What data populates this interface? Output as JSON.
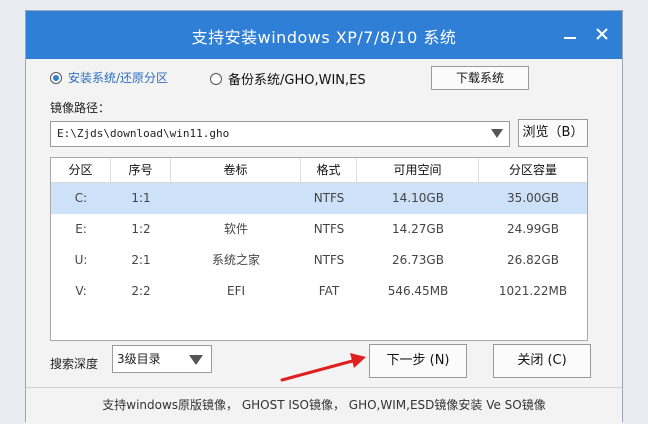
{
  "window": {
    "title": "支持安装windows XP/7/8/10 系统",
    "minimize_label": "minimize",
    "close_label": "close"
  },
  "mode": {
    "install_label": "安装系统/还原分区",
    "backup_label": "备份系统/GHO,WIN,ES",
    "selected": "install",
    "download_button": "下载系统"
  },
  "image_path": {
    "label": "镜像路径：",
    "value": "E:\\Zjds\\download\\win11.gho",
    "browse_button": "浏览（B）"
  },
  "partition_table": {
    "headers": [
      "分区",
      "序号",
      "卷标",
      "格式",
      "可用空间",
      "分区容量"
    ],
    "rows": [
      {
        "drive": "C:",
        "index": "1:1",
        "label": "",
        "format": "NTFS",
        "free": "14.10GB",
        "capacity": "35.00GB",
        "selected": true
      },
      {
        "drive": "E:",
        "index": "1:2",
        "label": "软件",
        "format": "NTFS",
        "free": "14.27GB",
        "capacity": "24.99GB",
        "selected": false
      },
      {
        "drive": "U:",
        "index": "2:1",
        "label": "系统之家",
        "format": "NTFS",
        "free": "26.73GB",
        "capacity": "26.82GB",
        "selected": false
      },
      {
        "drive": "V:",
        "index": "2:2",
        "label": "EFI",
        "format": "FAT",
        "free": "546.45MB",
        "capacity": "1021.22MB",
        "selected": false
      }
    ]
  },
  "search_depth": {
    "label": "搜索深度",
    "value": "3级目录"
  },
  "actions": {
    "next_button": "下一步 (N)",
    "close_button": "关闭 (C)"
  },
  "footer": {
    "text": "支持windows原版镜像， GHOST ISO镜像， GHO,WIM,ESD镜像安装 Ve SO镜像"
  },
  "colors": {
    "titlebar": "#2f7fd6",
    "selected_row": "#cde2f8",
    "annotation_arrow": "#e02020"
  }
}
